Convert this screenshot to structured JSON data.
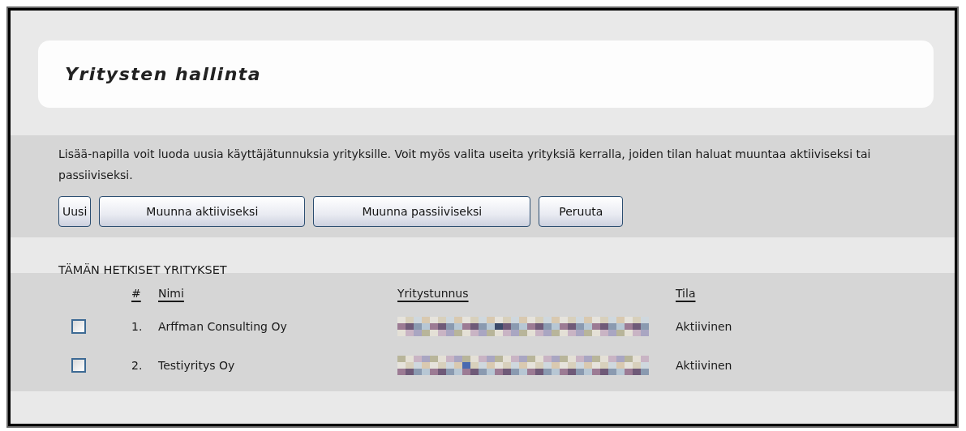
{
  "page_title": "Yritysten hallinta",
  "description": "Lisää-napilla voit luoda uusia käyttäjätunnuksia yrityksille. Voit myös valita useita yrityksiä kerralla, joiden tilan haluat muuntaa aktiiviseksi tai passiiviseksi.",
  "buttons": [
    {
      "label": "Uusi"
    },
    {
      "label": "Muunna aktiiviseksi"
    },
    {
      "label": "Muunna passiiviseksi"
    },
    {
      "label": "Peruuta"
    }
  ],
  "section_title": "TÄMÄN HETKISET YRITYKSET",
  "table": {
    "columns": [
      "#",
      "Nimi",
      "Yritystunnus",
      "Tila"
    ],
    "rows": [
      {
        "checked": false,
        "number": "1.",
        "name": "Arffman Consulting Oy",
        "status": "Aktiivinen"
      },
      {
        "checked": false,
        "number": "2.",
        "name": "Testiyritys Oy",
        "status": "Aktiivinen"
      }
    ]
  }
}
